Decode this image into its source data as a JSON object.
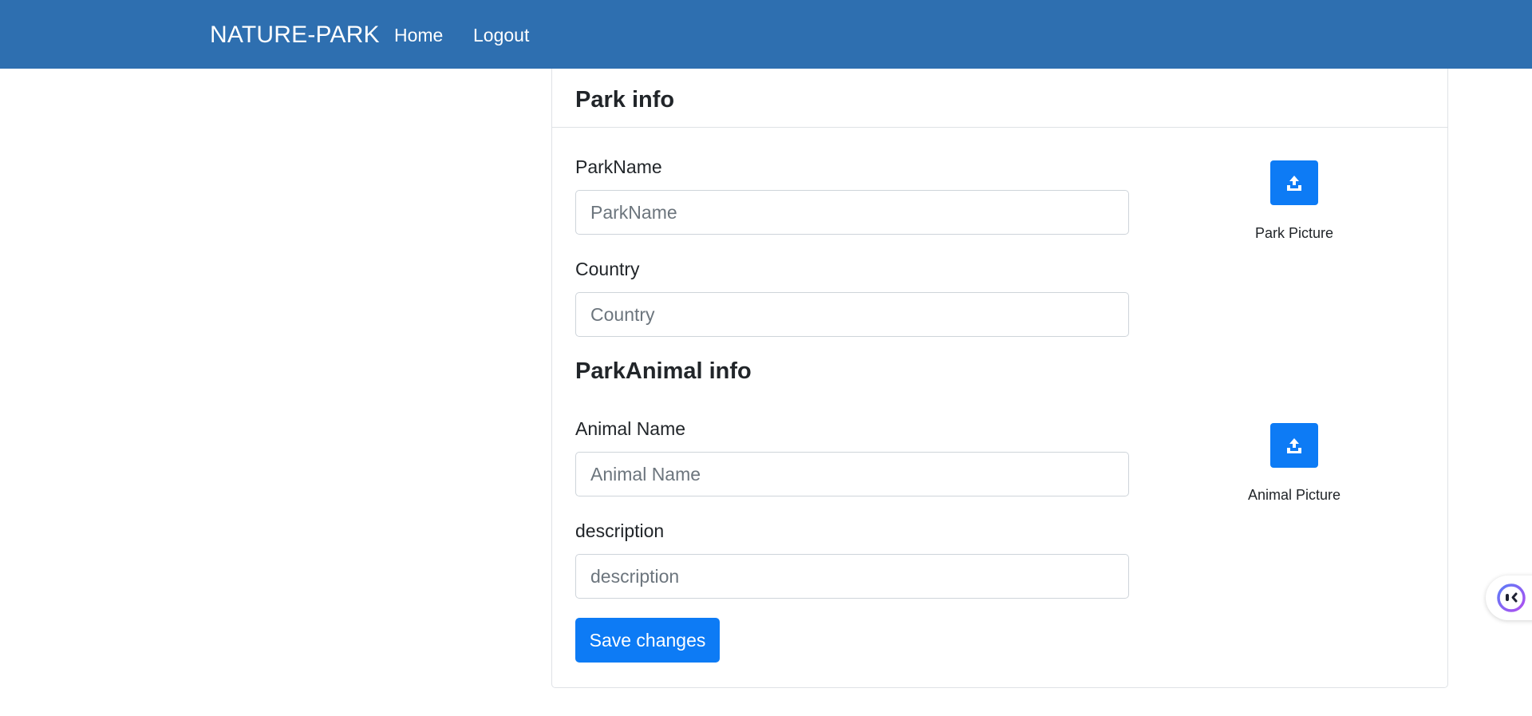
{
  "navbar": {
    "brand": "NATURE-PARK",
    "links": {
      "home": "Home",
      "logout": "Logout"
    },
    "background_color": "#2e6fb0"
  },
  "card": {
    "title": "Park info",
    "park_fields": {
      "park_name": {
        "label": "ParkName",
        "placeholder": "ParkName",
        "value": ""
      },
      "country": {
        "label": "Country",
        "placeholder": "Country",
        "value": ""
      }
    },
    "park_picture": {
      "icon": "upload-icon",
      "caption": "Park Picture"
    },
    "animal_section_title": "ParkAnimal info",
    "animal_fields": {
      "animal_name": {
        "label": "Animal Name",
        "placeholder": "Animal Name",
        "value": ""
      },
      "description": {
        "label": "description",
        "placeholder": "description",
        "value": ""
      }
    },
    "animal_picture": {
      "icon": "upload-icon",
      "caption": "Animal Picture"
    },
    "save_label": "Save changes",
    "accent_color": "#0d7bf5"
  },
  "assistant": {
    "icon": "assistant-face-icon"
  }
}
